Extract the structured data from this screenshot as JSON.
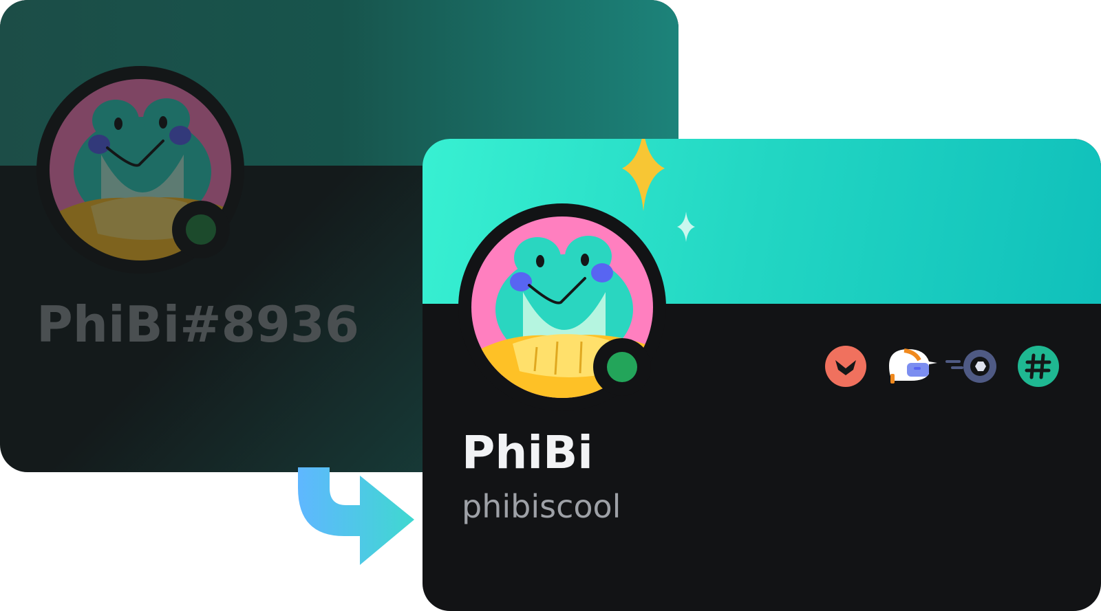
{
  "legacy_profile": {
    "tag_name": "PhiBi#8936",
    "status": "online",
    "avatar_icon": "frog-avatar-icon"
  },
  "new_profile": {
    "display_name": "PhiBi",
    "username": "phibiscool",
    "status": "online",
    "avatar_icon": "frog-avatar-icon",
    "badges": [
      "hypesquad-bravery-badge-icon",
      "quest-helmet-badge-icon",
      "nitro-speed-badge-icon",
      "hashtag-badge-icon"
    ]
  },
  "colors": {
    "new_banner_start": "#38f0d2",
    "new_banner_end": "#10c0bb",
    "old_banner": "#17544c",
    "status_online": "#23a55a",
    "avatar_bg": "#ff7fbf",
    "arrow_start": "#5fb7ff",
    "arrow_end": "#3fd8d0"
  }
}
